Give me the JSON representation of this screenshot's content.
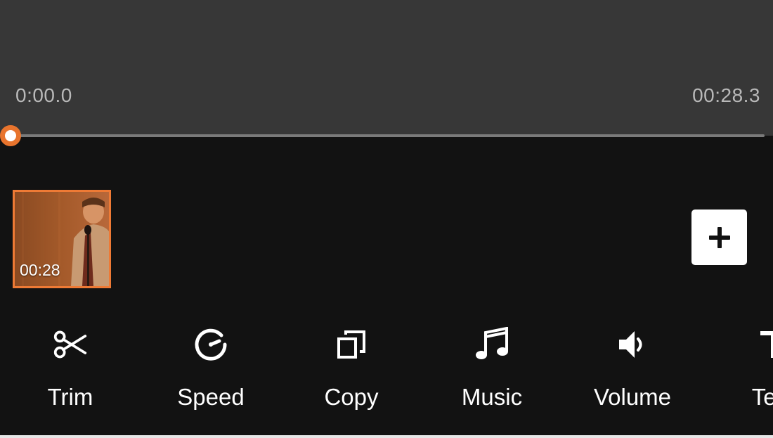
{
  "preview": {
    "current_time": "0:00.0",
    "total_time": "00:28.3",
    "progress": 0
  },
  "timeline": {
    "clips": [
      {
        "duration": "00:28"
      }
    ]
  },
  "colors": {
    "accent": "#e8742d",
    "background": "#121212",
    "preview_background": "#373737"
  },
  "toolbar": {
    "tools": [
      {
        "label": "Trim",
        "icon": "scissors-icon"
      },
      {
        "label": "Speed",
        "icon": "speedometer-icon"
      },
      {
        "label": "Copy",
        "icon": "copy-icon"
      },
      {
        "label": "Music",
        "icon": "music-note-icon"
      },
      {
        "label": "Volume",
        "icon": "volume-icon"
      },
      {
        "label": "Text",
        "icon": "text-icon"
      }
    ]
  }
}
